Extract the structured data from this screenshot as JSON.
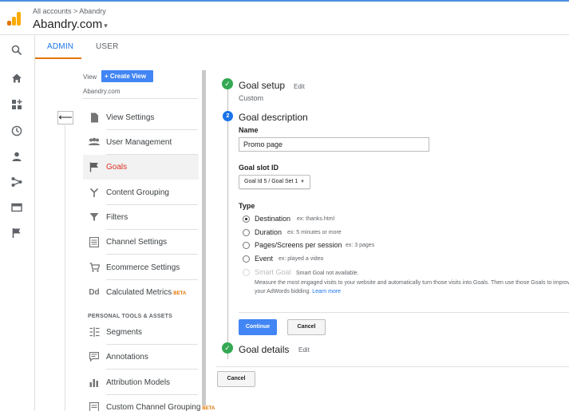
{
  "header": {
    "breadcrumb": "All accounts > Abandry",
    "account_name": "Abandry.com",
    "account_caret": "▾"
  },
  "tabs": {
    "admin": "ADMIN",
    "user": "USER"
  },
  "back_button": "⟵",
  "view": {
    "label": "View",
    "create_button": "+ Create View",
    "name": "Abandry.com"
  },
  "nav": {
    "items": [
      {
        "label": "View Settings"
      },
      {
        "label": "User Management"
      },
      {
        "label": "Goals"
      },
      {
        "label": "Content Grouping"
      },
      {
        "label": "Filters"
      },
      {
        "label": "Channel Settings"
      },
      {
        "label": "Ecommerce Settings"
      },
      {
        "label": "Calculated Metrics",
        "badge": "BETA"
      }
    ],
    "section_title": "PERSONAL TOOLS & ASSETS",
    "tools": [
      {
        "label": "Segments"
      },
      {
        "label": "Annotations"
      },
      {
        "label": "Attribution Models"
      },
      {
        "label": "Custom Channel Grouping",
        "badge": "BETA"
      }
    ]
  },
  "goal": {
    "step1": {
      "title": "Goal setup",
      "edit": "Edit",
      "summary": "Custom"
    },
    "step2": {
      "number": "2",
      "title": "Goal description"
    },
    "name_label": "Name",
    "name_value": "Promo page",
    "slot_label": "Goal slot ID",
    "slot_value": "Goal Id 5 / Goal Set 1",
    "type_label": "Type",
    "types": [
      {
        "label": "Destination",
        "hint": "ex: thanks.html",
        "selected": true
      },
      {
        "label": "Duration",
        "hint": "ex: 5 minutes or more"
      },
      {
        "label": "Pages/Screens per session",
        "hint": "ex: 3 pages"
      },
      {
        "label": "Event",
        "hint": "ex: played a video"
      },
      {
        "label": "Smart Goal",
        "hint": "Smart Goal not available.",
        "disabled": true
      }
    ],
    "smart_note": "Measure the most engaged visits to your website and automatically turn those visits into Goals. Then use those Goals to improve your AdWords bidding.",
    "learn_more": "Learn more",
    "continue": "Continue",
    "cancel": "Cancel",
    "step3": {
      "title": "Goal details",
      "edit": "Edit"
    },
    "bottom_cancel": "Cancel"
  },
  "colors": {
    "accent": "#4285f4",
    "active_tab_underline": "#e37400",
    "active_nav": "#d93025",
    "success": "#34a853"
  }
}
